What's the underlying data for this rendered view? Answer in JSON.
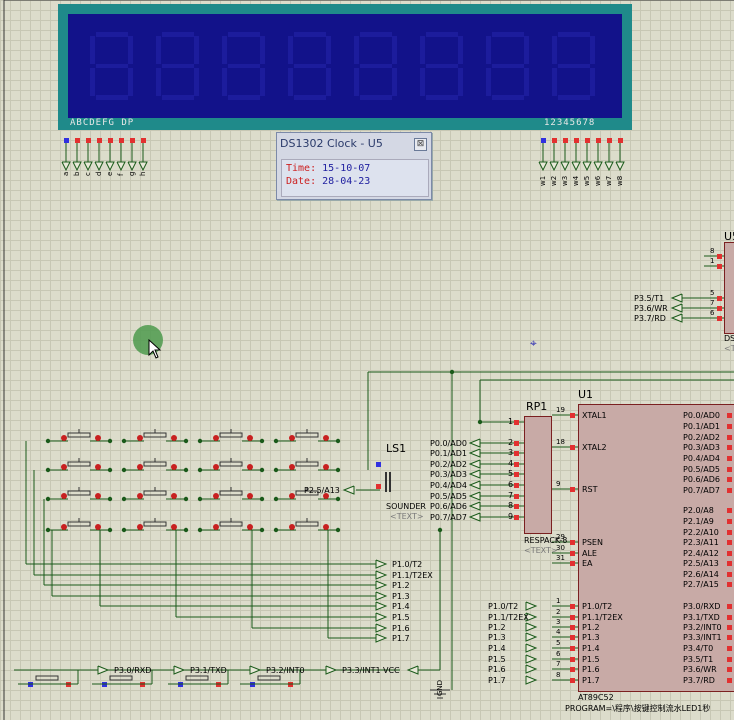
{
  "lcd": {
    "left_label": "ABCDEFG DP",
    "right_label": "12345678",
    "segment_pins": [
      "a",
      "b",
      "c",
      "d",
      "e",
      "f",
      "g",
      "h"
    ],
    "digit_pins": [
      "w1",
      "w2",
      "w3",
      "w4",
      "w5",
      "w6",
      "w7",
      "w8"
    ]
  },
  "ds1302": {
    "title": "DS1302 Clock - U5",
    "close": "⊠",
    "time_label": "Time:",
    "time_value": "15-10-07",
    "date_label": "Date:",
    "date_value": "28-04-23"
  },
  "u1": {
    "ref": "U1",
    "part": "AT89C52",
    "program": "PROGRAM=\\程序\\按键控制流水LED1秒",
    "left_pins": [
      {
        "num": "19",
        "name": "XTAL1"
      },
      {
        "num": "18",
        "name": "XTAL2"
      },
      {
        "num": "9",
        "name": "RST"
      },
      {
        "num": "29",
        "name": "PSEN"
      },
      {
        "num": "30",
        "name": "ALE"
      },
      {
        "num": "31",
        "name": "EA"
      },
      {
        "num": "1",
        "name": "P1.0/T2"
      },
      {
        "num": "2",
        "name": "P1.1/T2EX"
      },
      {
        "num": "3",
        "name": "P1.2"
      },
      {
        "num": "4",
        "name": "P1.3"
      },
      {
        "num": "5",
        "name": "P1.4"
      },
      {
        "num": "6",
        "name": "P1.5"
      },
      {
        "num": "7",
        "name": "P1.6"
      },
      {
        "num": "8",
        "name": "P1.7"
      }
    ],
    "right_pins": [
      "P0.0/AD0",
      "P0.1/AD1",
      "P0.2/AD2",
      "P0.3/AD3",
      "P0.4/AD4",
      "P0.5/AD5",
      "P0.6/AD6",
      "P0.7/AD7",
      "P2.0/A8",
      "P2.1/A9",
      "P2.2/A10",
      "P2.3/A11",
      "P2.4/A12",
      "P2.5/A13",
      "P2.6/A14",
      "P2.7/A15",
      "P3.0/RXD",
      "P3.1/TXD",
      "P3.2/INT0",
      "P3.3/INT1",
      "P3.4/T0",
      "P3.5/T1",
      "P3.6/WR",
      "P3.7/RD"
    ]
  },
  "rp1": {
    "ref": "RP1",
    "part": "RESPACK-8",
    "text": "<TEXT>",
    "pins": [
      "1",
      "2",
      "3",
      "4",
      "5",
      "6",
      "7",
      "8",
      "9"
    ],
    "port_labels": [
      "P0.0/AD0",
      "P0.1/AD1",
      "P0.2/AD2",
      "P0.3/AD3",
      "P0.4/AD4",
      "P0.5/AD5",
      "P0.6/AD6",
      "P0.7/AD7"
    ]
  },
  "ls1": {
    "ref": "LS1",
    "part": "SOUNDER",
    "text": "<TEXT>",
    "net": "P2.5/A13"
  },
  "p1_labels_left": [
    "P1.0/T2",
    "P1.1/T2EX",
    "P1.2",
    "P1.3",
    "P1.4",
    "P1.5",
    "P1.6",
    "P1.7"
  ],
  "p1_labels_chip": [
    "P1.0/T2",
    "P1.1/T2EX",
    "P1.2",
    "P1.3",
    "P1.4",
    "P1.5",
    "P1.6",
    "P1.7"
  ],
  "p3_bottom": [
    "P3.0/RXD",
    "P3.1/TXD",
    "P3.2/INT0",
    "P3.3/INT1"
  ],
  "vcc": "VCC",
  "gnd": "GND",
  "u5": {
    "ref": "U5",
    "pins": [
      "8",
      "1"
    ],
    "nets": [
      "P3.5/T1",
      "P3.6/WR",
      "P3.7/RD"
    ],
    "net_pins": [
      "5",
      "7",
      "6"
    ],
    "part_partial": "DS",
    "text_partial": "<T"
  },
  "colors": {
    "wire": "#1a5a1a",
    "pin_red": "#e23030",
    "pin_blue": "#3030e0",
    "chip_fill": "#c8aaa6",
    "lcd_frame": "#1f8a8a",
    "lcd_screen": "#12128a"
  }
}
